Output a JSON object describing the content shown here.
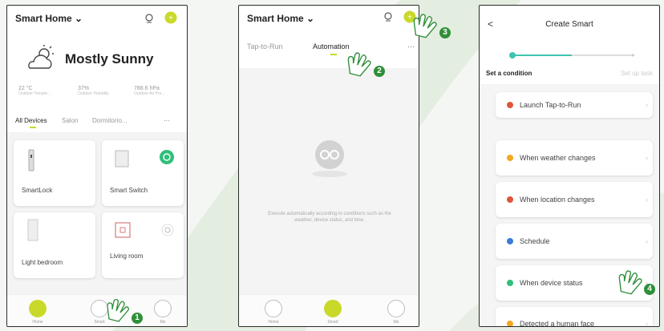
{
  "colors": {
    "accent": "#c9d92a",
    "green": "#2fbf7a",
    "badge": "#2f8f3a",
    "teal": "#3fc4b0"
  },
  "screen1": {
    "title": "Smart Home",
    "weather": "Mostly Sunny",
    "stats": [
      {
        "value": "22 °C",
        "label": "Outdoor Temper..."
      },
      {
        "value": "37%",
        "label": "Outdoor Humidity"
      },
      {
        "value": "788.6 hPa",
        "label": "Outdoor Air Pre..."
      }
    ],
    "tabs": [
      "All Devices",
      "Salon",
      "Dormitorio..."
    ],
    "more": "···",
    "devices": [
      {
        "name": "SmartLock"
      },
      {
        "name": "Smart Switch"
      },
      {
        "name": "Light bedroom"
      },
      {
        "name": "Living room"
      }
    ],
    "nav": [
      "Home",
      "Smart",
      "Me"
    ],
    "step": "1"
  },
  "screen2": {
    "title": "Smart Home",
    "tabs": [
      "Tap-to-Run",
      "Automation"
    ],
    "more": "···",
    "empty_text": "Execute automatically according to conditions such as the weather, device status, and time.",
    "nav": [
      "Home",
      "Smart",
      "Me"
    ],
    "steps": [
      "2",
      "3"
    ]
  },
  "screen3": {
    "back": "<",
    "title": "Create Smart",
    "step_left": "Set a condition",
    "step_right": "Set up task",
    "items": [
      {
        "label": "Launch Tap-to-Run",
        "icon": "hand-icon",
        "color": "#e0553b"
      },
      {
        "label": "When weather changes",
        "icon": "sun-icon",
        "color": "#f5a623"
      },
      {
        "label": "When location changes",
        "icon": "location-icon",
        "color": "#e0553b"
      },
      {
        "label": "Schedule",
        "icon": "clock-icon",
        "color": "#3a7bd5"
      },
      {
        "label": "When device status",
        "icon": "device-icon",
        "color": "#2fbf7a"
      },
      {
        "label": "Detected a human face",
        "icon": "face-icon",
        "color": "#f5a623"
      }
    ],
    "step": "4"
  }
}
